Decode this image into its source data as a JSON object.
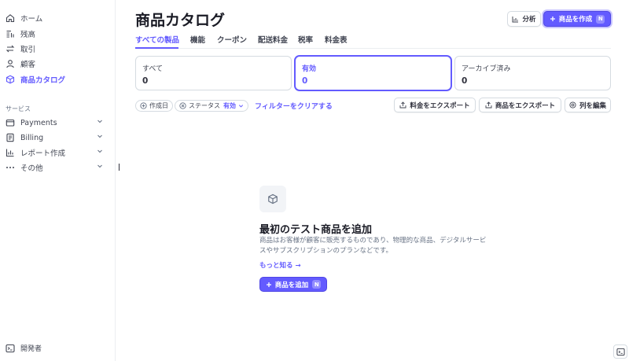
{
  "sidebar": {
    "items": [
      {
        "label": "ホーム",
        "icon": "home-icon"
      },
      {
        "label": "残高",
        "icon": "balance-icon"
      },
      {
        "label": "取引",
        "icon": "transactions-icon"
      },
      {
        "label": "顧客",
        "icon": "customer-icon"
      },
      {
        "label": "商品カタログ",
        "icon": "box-icon",
        "active": true
      }
    ],
    "section_label": "サービス",
    "services": [
      {
        "label": "Payments",
        "icon": "wallet-icon"
      },
      {
        "label": "Billing",
        "icon": "billing-icon"
      },
      {
        "label": "レポート作成",
        "icon": "report-icon"
      },
      {
        "label": "その他",
        "icon": "more-icon"
      }
    ],
    "developer_label": "開発者"
  },
  "header": {
    "title": "商品カタログ",
    "analytics_label": "分析",
    "create_label": "商品を作成",
    "create_shortcut": "N"
  },
  "tabs": [
    {
      "label": "すべての製品",
      "active": true
    },
    {
      "label": "機能"
    },
    {
      "label": "クーポン"
    },
    {
      "label": "配送料金"
    },
    {
      "label": "税率"
    },
    {
      "label": "料金表"
    }
  ],
  "status_cards": [
    {
      "label": "すべて",
      "count": "0"
    },
    {
      "label": "有効",
      "count": "0",
      "active": true
    },
    {
      "label": "アーカイブ済み",
      "count": "0"
    }
  ],
  "filters": {
    "created_label": "作成日",
    "status_label": "ステータス",
    "status_value": "有効",
    "clear_label": "フィルターをクリアする"
  },
  "toolbar": {
    "export_prices_label": "料金をエクスポート",
    "export_products_label": "商品をエクスポート",
    "edit_columns_label": "列を編集"
  },
  "empty_state": {
    "title": "最初のテスト商品を追加",
    "description": "商品はお客様が顧客に販売するものであり、物理的な商品、デジタルサービスやサブスクリプションのプランなどです。",
    "learn_more": "もっと知る →",
    "add_label": "商品を追加",
    "add_shortcut": "N"
  },
  "colors": {
    "accent": "#635bff",
    "text": "#30313d",
    "muted": "#687385",
    "border": "#d5dbe1"
  }
}
